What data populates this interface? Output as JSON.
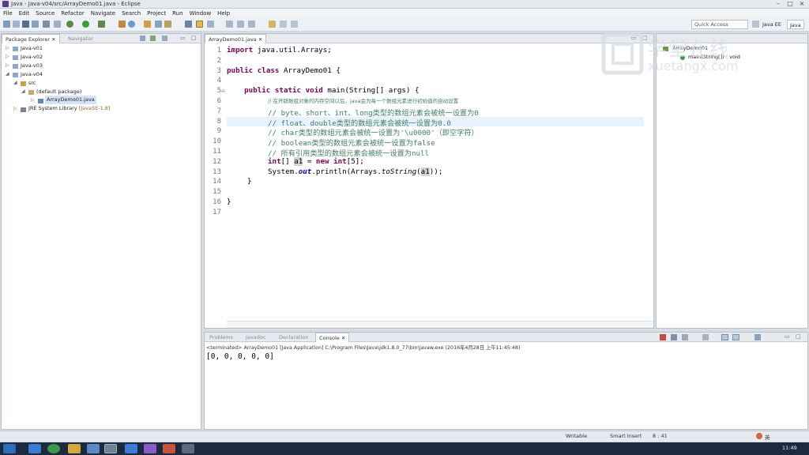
{
  "window": {
    "title": "Java - Java-v04/src/ArrayDemo01.java - Eclipse"
  },
  "menu": [
    "File",
    "Edit",
    "Source",
    "Refactor",
    "Navigate",
    "Search",
    "Project",
    "Run",
    "Window",
    "Help"
  ],
  "toolbar": {
    "quick_access_placeholder": "Quick Access",
    "perspectives": [
      "Java EE",
      "Java"
    ]
  },
  "package_explorer": {
    "tabs": [
      "Package Explorer",
      "Navigator"
    ],
    "items": [
      "Java-v01",
      "Java-v02",
      "Java-v03",
      "Java-v04",
      "src",
      "(default package)",
      "ArrayDemo01.java",
      "JRE System Library",
      "[JavaSE-1.8]"
    ]
  },
  "editor": {
    "tab_label": "ArrayDemo01.java",
    "line_numbers": [
      "1",
      "2",
      "3",
      "4",
      "5",
      "6",
      "7",
      "8",
      "9",
      "10",
      "11",
      "12",
      "13",
      "14",
      "15",
      "16",
      "17"
    ],
    "code": {
      "l1a": "import",
      "l1b": " java.util.Arrays;",
      "l3a": "public",
      "l3b": "class",
      "l3c": " ArrayDemo01 {",
      "l5a": "public",
      "l5b": "static",
      "l5c": "void",
      "l5d": " main(String[] args) {",
      "l6": "// 在开辟数组对象的内存空间以后，java会为每一个数组元素进行初始值的自动设置",
      "l7": "// byte、short、int、long类型的数组元素会被统一设置为0",
      "l8": "// float、double类型的数组元素会被统一设置为0.0",
      "l9": "// char类型的数组元素会被统一设置为'\\u0000'（即空字符）",
      "l10": "// boolean类型的数组元素会被统一设置为false",
      "l11": "// 所有引用类型的数组元素会被统一设置为null",
      "l12a": "int",
      "l12b": "[] ",
      "l12c": "a1",
      "l12d": " = ",
      "l12e": "new",
      "l12f": " ",
      "l12g": "int",
      "l12h": "[5];",
      "l13a": "System.",
      "l13b": "out",
      "l13c": ".println(Arrays.",
      "l13d": "toString",
      "l13e": "(",
      "l13f": "a1",
      "l13g": "));",
      "l14": "}",
      "l16": "}"
    }
  },
  "outline": {
    "items": [
      "ArrayDemo01",
      "main(String[]) : void"
    ]
  },
  "console": {
    "tabs": [
      "Problems",
      "Javadoc",
      "Declaration",
      "Console"
    ],
    "terminated": "<terminated> ArrayDemo01 [Java Application] C:\\Program Files\\Java\\jdk1.8.0_77\\bin\\javaw.exe (2016年4月28日 上午11:45:48)",
    "output": "[0, 0, 0, 0, 0]"
  },
  "status": {
    "writable": "Writable",
    "insert": "Smart Insert",
    "position": "8 : 41"
  },
  "taskbar": {
    "clock": "11:49",
    "ime": "英"
  },
  "watermark": {
    "cn": "学堂在线",
    "en": "xuetangx.com"
  },
  "colors": {
    "keyword": "#7f0055",
    "comment": "#3f7f5f",
    "field": "#0000c0",
    "current_line": "#e8f2fe"
  }
}
